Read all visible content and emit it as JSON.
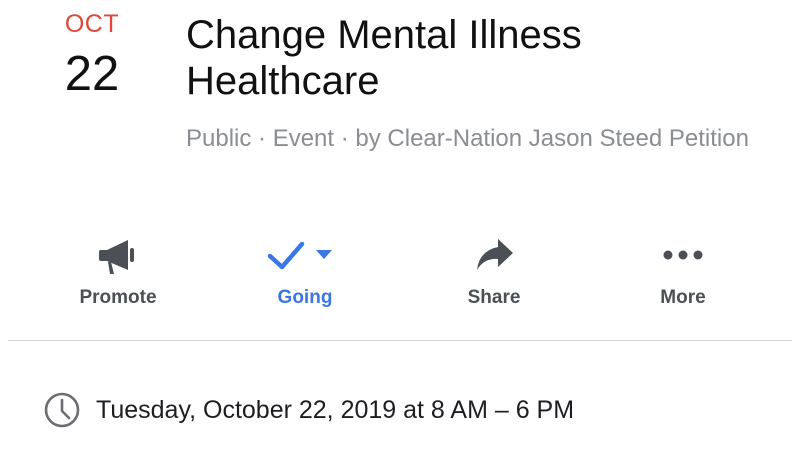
{
  "event": {
    "month": "OCT",
    "day": "22",
    "title": "Change Mental Illness Healthcare",
    "meta": "Public · Event · by Clear-Nation Jason Steed Petition"
  },
  "actions": [
    {
      "label": "Promote",
      "icon": "megaphone-icon",
      "active": false
    },
    {
      "label": "Going",
      "icon": "checkmark-icon",
      "active": true
    },
    {
      "label": "Share",
      "icon": "share-arrow-icon",
      "active": false
    },
    {
      "label": "More",
      "icon": "more-dots-icon",
      "active": false
    }
  ],
  "details": {
    "time": "Tuesday, October 22, 2019 at 8 AM – 6 PM",
    "time_icon": "clock-icon"
  },
  "colors": {
    "month_accent": "#e0473c",
    "active_blue": "#3b76e6",
    "icon_gray": "#4b4f56",
    "meta_gray": "#8a8d91"
  }
}
